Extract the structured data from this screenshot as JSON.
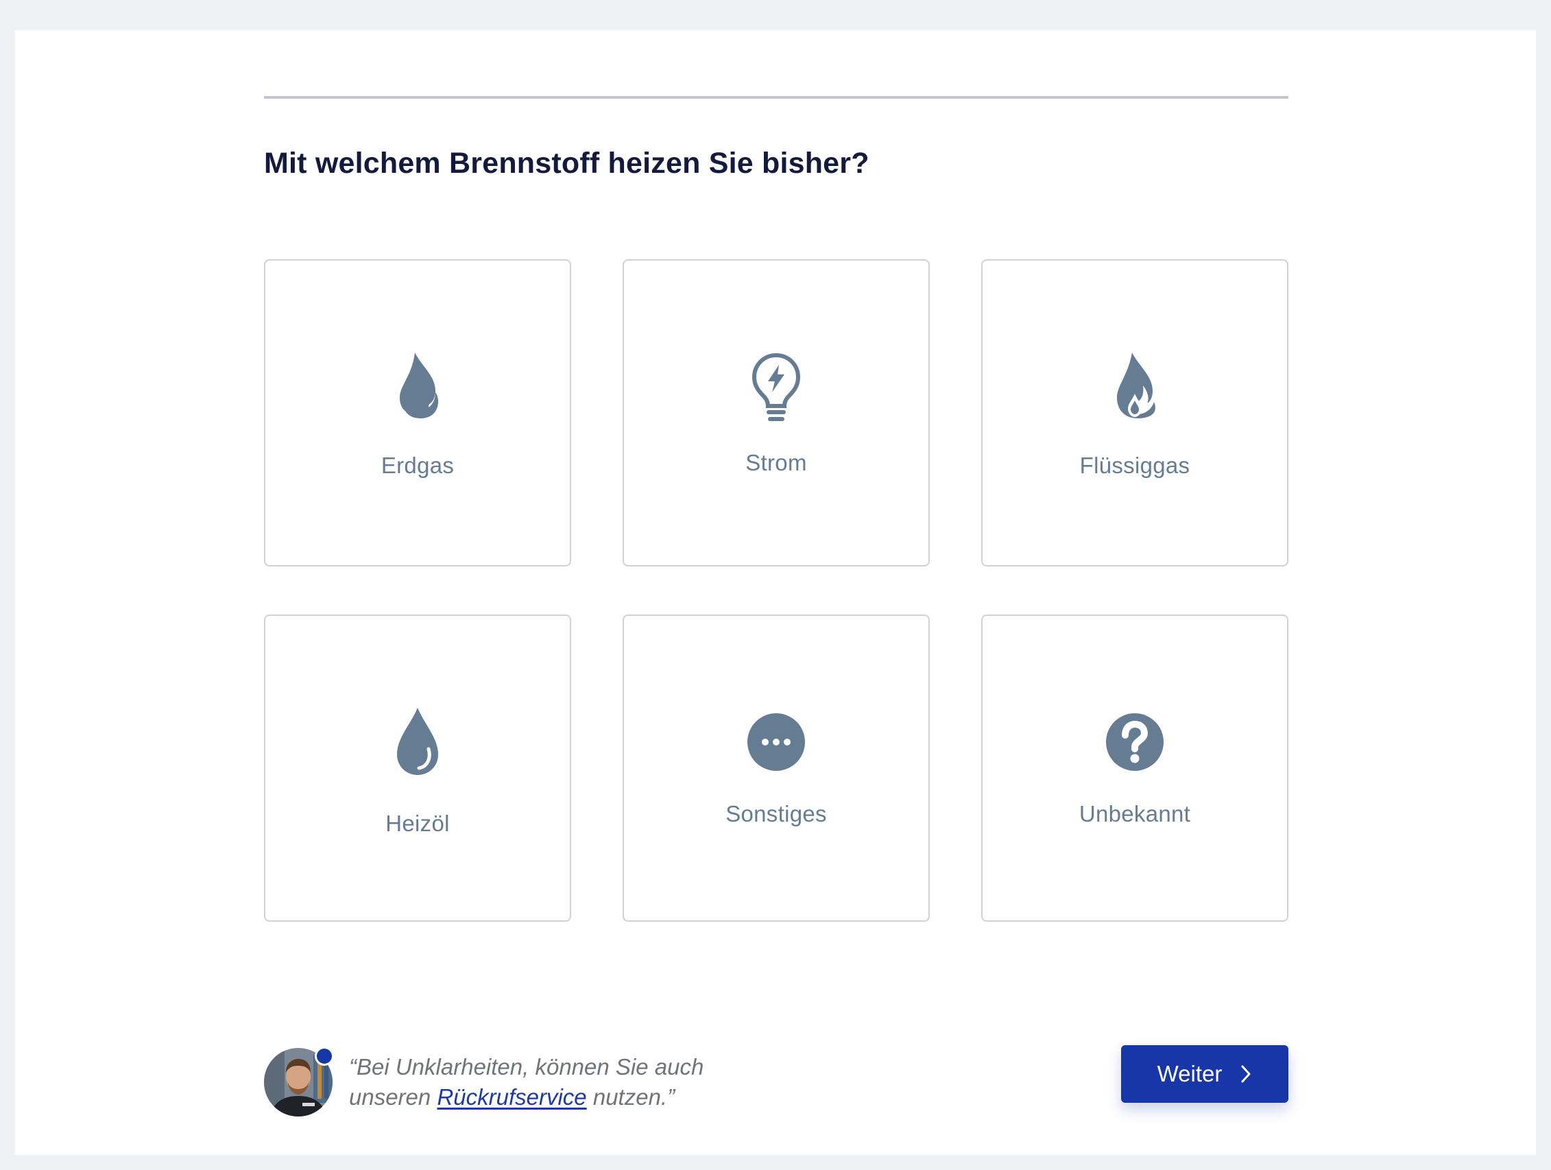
{
  "page": {
    "question": "Mit welchem Brennstoff heizen Sie bisher?"
  },
  "options": [
    {
      "label": "Erdgas",
      "icon": "flame-icon"
    },
    {
      "label": "Strom",
      "icon": "lightbulb-bolt-icon"
    },
    {
      "label": "Flüssiggas",
      "icon": "flame-drop-icon"
    },
    {
      "label": "Heizöl",
      "icon": "oil-drop-icon"
    },
    {
      "label": "Sonstiges",
      "icon": "more-dots-icon"
    },
    {
      "label": "Unbekannt",
      "icon": "question-icon"
    }
  ],
  "footer": {
    "quote_before": "“Bei Unklarheiten, können Sie auch unseren ",
    "callback_link": "Rückrufservice",
    "quote_after": " nutzen.”",
    "next_label": "Weiter"
  },
  "colors": {
    "icon": "#667c93",
    "heading": "#131a3c",
    "accent": "#1737a8",
    "tile_border": "#d0d2d6",
    "background": "#eef0f4"
  }
}
